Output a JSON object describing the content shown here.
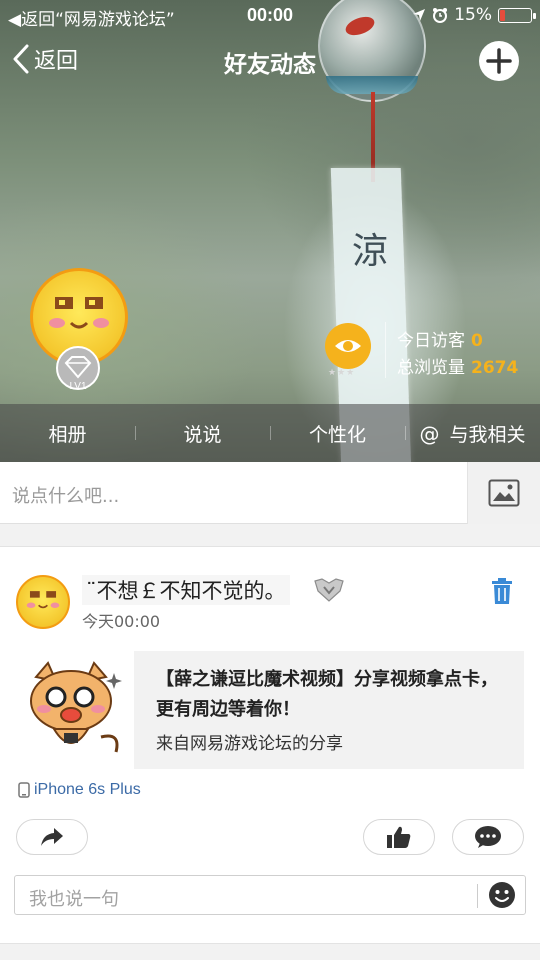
{
  "status_bar": {
    "back_label": "返回“网易游戏论坛”",
    "time": "00:00",
    "battery": "15%",
    "battery_level": 0.15
  },
  "nav": {
    "back_label": "返回",
    "title": "好友动态"
  },
  "profile": {
    "level": "LV1"
  },
  "visits": {
    "today_label": "今日访客",
    "today_value": "0",
    "total_label": "总浏览量",
    "total_value": "2674"
  },
  "tabs": [
    {
      "label": "相册"
    },
    {
      "label": "说说"
    },
    {
      "label": "个性化"
    },
    {
      "label": "与我相关",
      "icon": "at-icon"
    }
  ],
  "composer": {
    "placeholder": "说点什么吧..."
  },
  "post": {
    "author": "¨不想￡不知不觉的。",
    "time": "今天00:00",
    "share_title": "【薛之谦逗比魔术视频】分享视频拿点卡，更有周边等着你！",
    "share_source": "来自网易游戏论坛的分享",
    "device": "iPhone 6s Plus",
    "comment_placeholder": "我也说一句"
  },
  "colors": {
    "accent": "#f5b21c",
    "link": "#3b6aa6",
    "delete": "#3a8ad6"
  }
}
